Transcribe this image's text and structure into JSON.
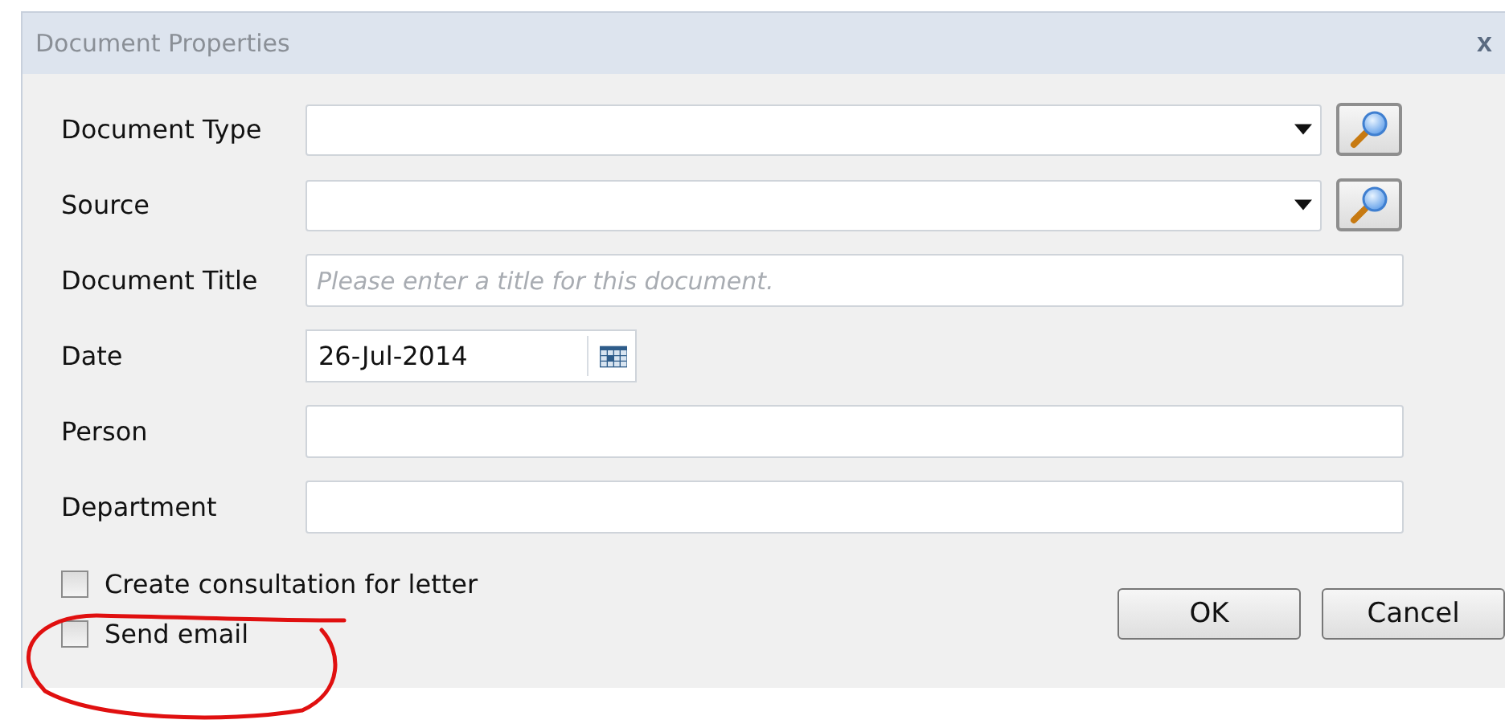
{
  "window": {
    "title": "Document Properties",
    "close": "x"
  },
  "fields": [
    {
      "kind": "combo",
      "label": "Document Type"
    },
    {
      "kind": "combo",
      "label": "Source"
    },
    {
      "kind": "text",
      "label": "Document Title",
      "placeholder": "Please enter a title for this document."
    },
    {
      "kind": "date",
      "label": "Date",
      "value": "26-Jul-2014"
    },
    {
      "kind": "text",
      "label": "Person"
    },
    {
      "kind": "text",
      "label": "Department"
    }
  ],
  "checkboxes": [
    {
      "label": "Create consultation for letter",
      "checked": false
    },
    {
      "label": "Send email",
      "checked": false
    }
  ],
  "buttons": [
    "OK",
    "Cancel"
  ]
}
